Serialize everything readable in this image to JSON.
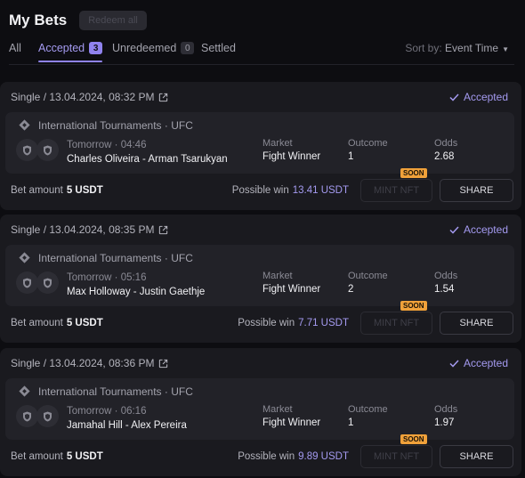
{
  "header": {
    "title": "My Bets",
    "redeem_all_label": "Redeem all"
  },
  "tabs": [
    {
      "label": "All"
    },
    {
      "label": "Accepted",
      "count": "3"
    },
    {
      "label": "Unredeemed",
      "count": "0"
    },
    {
      "label": "Settled"
    }
  ],
  "sort": {
    "label": "Sort by:",
    "value": "Event Time"
  },
  "columns": {
    "market": "Market",
    "outcome": "Outcome",
    "odds": "Odds"
  },
  "labels": {
    "bet_amount": "Bet amount",
    "possible_win": "Possible win",
    "mint_nft": "MINT NFT",
    "soon": "SOON",
    "share": "SHARE"
  },
  "colors": {
    "accent": "#8f82ee",
    "soon_badge": "#f0a13a",
    "background": "#0d0d11",
    "card": "#1a1a1f"
  },
  "bets": [
    {
      "title": "Single / 13.04.2024, 08:32 PM",
      "status": "Accepted",
      "league": "International Tournaments · UFC",
      "time": "Tomorrow · 04:46",
      "event": "Charles Oliveira - Arman Tsarukyan",
      "market": "Fight Winner",
      "outcome": "1",
      "odds": "2.68",
      "bet_amount": "5 USDT",
      "possible_win": "13.41 USDT"
    },
    {
      "title": "Single / 13.04.2024, 08:35 PM",
      "status": "Accepted",
      "league": "International Tournaments · UFC",
      "time": "Tomorrow · 05:16",
      "event": "Max Holloway - Justin Gaethje",
      "market": "Fight Winner",
      "outcome": "2",
      "odds": "1.54",
      "bet_amount": "5 USDT",
      "possible_win": "7.71 USDT"
    },
    {
      "title": "Single / 13.04.2024, 08:36 PM",
      "status": "Accepted",
      "league": "International Tournaments · UFC",
      "time": "Tomorrow · 06:16",
      "event": "Jamahal Hill - Alex Pereira",
      "market": "Fight Winner",
      "outcome": "1",
      "odds": "1.97",
      "bet_amount": "5 USDT",
      "possible_win": "9.89 USDT"
    }
  ]
}
